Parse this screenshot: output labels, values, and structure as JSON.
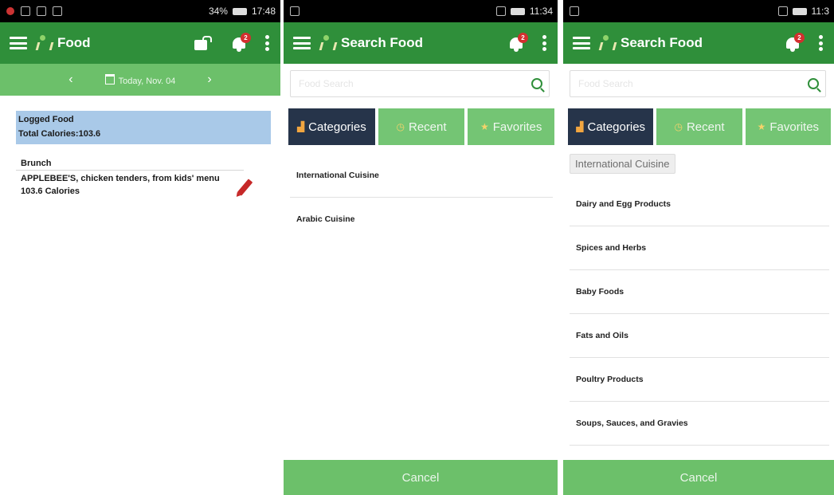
{
  "screen1": {
    "status_time": "17:48",
    "status_battery": "34%",
    "title": "Food",
    "notification_count": "2",
    "date_label": "Today, Nov. 04",
    "prev_arrow": "‹",
    "next_arrow": "›",
    "logged_title": "Logged Food",
    "total_calories": "Total Calories:103.6",
    "meal_name": "Brunch",
    "item_name": "APPLEBEE'S, chicken tenders, from kids' menu",
    "item_calories": "103.6 Calories"
  },
  "screen2": {
    "status_time": "11:34",
    "title": "Search Food",
    "notification_count": "2",
    "search_placeholder": "Food Search",
    "tabs": [
      "Categories",
      "Recent",
      "Favorites"
    ],
    "categories": [
      "International Cuisine",
      "Arabic Cuisine"
    ],
    "cancel_label": "Cancel"
  },
  "screen3": {
    "status_time": "11:3",
    "title": "Search Food",
    "notification_count": "2",
    "search_placeholder": "Food Search",
    "tabs": [
      "Categories",
      "Recent",
      "Favorites"
    ],
    "selected_chip": "International Cuisine",
    "categories": [
      "Dairy and Egg Products",
      "Spices and Herbs",
      "Baby Foods",
      "Fats and Oils",
      "Poultry Products",
      "Soups, Sauces, and Gravies"
    ],
    "cancel_label": "Cancel"
  },
  "colors": {
    "appbar": "#2f8f3a",
    "tab_active": "#26344a",
    "tab_inactive": "#74c574",
    "logged_bg": "#a9c9e8",
    "accent_red": "#d32f2f"
  }
}
